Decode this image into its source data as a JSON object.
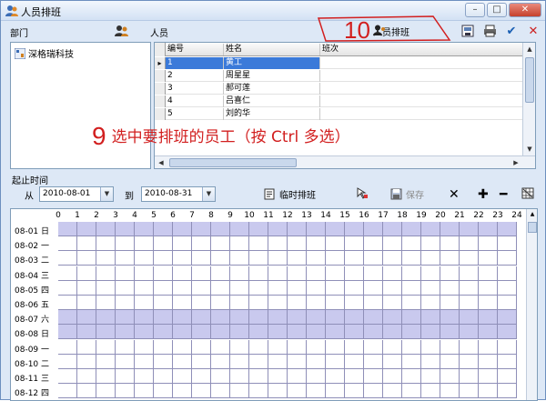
{
  "window": {
    "title": "人员排班",
    "btn_minimize": "–",
    "btn_maximize": "□",
    "btn_close": "✕"
  },
  "dept": {
    "header": "部门",
    "items": [
      "深格瑞科技"
    ]
  },
  "people": {
    "header": "人员",
    "columns": [
      "编号",
      "姓名",
      "班次"
    ],
    "rows": [
      {
        "no": "1",
        "name": "黄工",
        "shift": "",
        "selected": true
      },
      {
        "no": "2",
        "name": "周星星",
        "shift": "",
        "selected": false
      },
      {
        "no": "3",
        "name": "郝可莲",
        "shift": "",
        "selected": false
      },
      {
        "no": "4",
        "name": "吕喜仁",
        "shift": "",
        "selected": false
      },
      {
        "no": "5",
        "name": "刘的华",
        "shift": "",
        "selected": false
      }
    ]
  },
  "toolbar": {
    "schedule_button": "人员排班"
  },
  "annotations": {
    "step10_number": "10",
    "step9_number": "9",
    "step9_text": "选中要排班的员工（按 Ctrl 多选）"
  },
  "dates": {
    "section_label": "起止时间",
    "from_label": "从",
    "from_value": "2010-08-01",
    "to_label": "到",
    "to_value": "2010-08-31",
    "temp_schedule": "临时排班",
    "save": "保存"
  },
  "schedule": {
    "hours": [
      "0",
      "1",
      "2",
      "3",
      "4",
      "5",
      "6",
      "7",
      "8",
      "9",
      "10",
      "11",
      "12",
      "13",
      "14",
      "15",
      "16",
      "17",
      "18",
      "19",
      "20",
      "21",
      "22",
      "23",
      "24"
    ],
    "days": [
      {
        "label": "08-01 日",
        "weekend": true
      },
      {
        "label": "08-02 一",
        "weekend": false
      },
      {
        "label": "08-03 二",
        "weekend": false
      },
      {
        "label": "08-04 三",
        "weekend": false
      },
      {
        "label": "08-05 四",
        "weekend": false
      },
      {
        "label": "08-06 五",
        "weekend": false
      },
      {
        "label": "08-07 六",
        "weekend": true
      },
      {
        "label": "08-08 日",
        "weekend": true
      },
      {
        "label": "08-09 一",
        "weekend": false
      },
      {
        "label": "08-10 二",
        "weekend": false
      },
      {
        "label": "08-11 三",
        "weekend": false
      },
      {
        "label": "08-12 四",
        "weekend": false
      }
    ]
  },
  "colors": {
    "weekend_fill": "#c9c9ee",
    "selection": "#3b7ad9",
    "annotation_red": "#d21f1f"
  }
}
